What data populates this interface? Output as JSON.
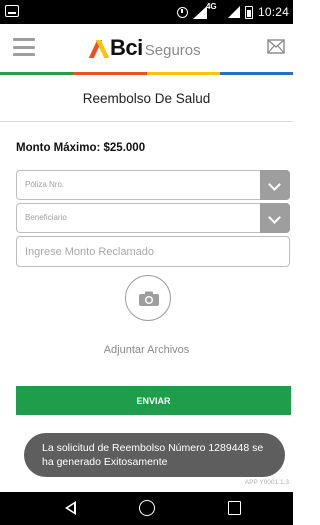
{
  "status_bar": {
    "network_label": "4G",
    "time": "10:24"
  },
  "app_bar": {
    "logo_text": "Bci",
    "logo_subtext": "Seguros",
    "brand_colors": [
      "#2e9b45",
      "#f04e23",
      "#ffc20e",
      "#2a6cc7"
    ]
  },
  "page": {
    "title": "Reembolso De Salud"
  },
  "form": {
    "monto_maximo": "Monto Máximo: $25.000",
    "poliza_placeholder": "Póliza Nro.",
    "beneficiario_placeholder": "Beneficiario",
    "monto_placeholder": "Ingrese Monto Reclamado",
    "adjuntar_label": "Adjuntar Archivos",
    "enviar_label": "ENVIAR"
  },
  "version_text": "APP Y0001.1.3",
  "toast": {
    "message": "La solicitud de Reembolso Número 1289448 se ha generado Exitosamente"
  }
}
